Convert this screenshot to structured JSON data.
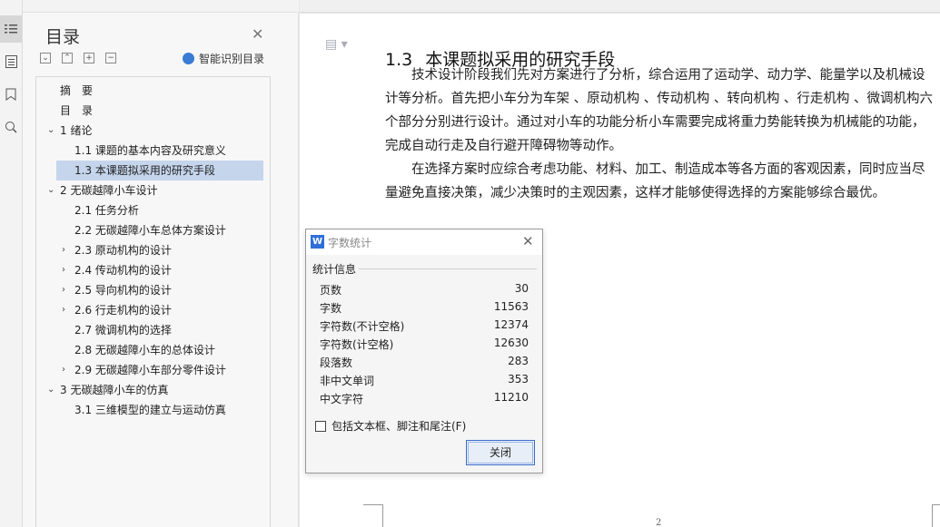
{
  "toc_panel": {
    "title": "目录",
    "smart_toc_label": "智能识别目录",
    "items": [
      {
        "label": "摘　要",
        "level": 0
      },
      {
        "label": "目　录",
        "level": 0
      },
      {
        "label": "1  绪论",
        "level": 0
      },
      {
        "label": "1.1    课题的基本内容及研究意义",
        "level": 1
      },
      {
        "label": "1.3    本课题拟采用的研究手段",
        "level": 1
      },
      {
        "label": "2  无碳越障小车设计",
        "level": 0
      },
      {
        "label": "2.1    任务分析",
        "level": 1
      },
      {
        "label": "2.2    无碳越障小车总体方案设计",
        "level": 1
      },
      {
        "label": "2.3    原动机构的设计",
        "level": 1
      },
      {
        "label": "2.4    传动机构的设计",
        "level": 1
      },
      {
        "label": "2.5    导向机构的设计",
        "level": 1
      },
      {
        "label": "2.6    行走机构的设计",
        "level": 1
      },
      {
        "label": "2.7    微调机构的选择",
        "level": 1
      },
      {
        "label": "2.8    无碳越障小车的总体设计",
        "level": 1
      },
      {
        "label": "2.9    无碳越障小车部分零件设计",
        "level": 1
      },
      {
        "label": "3   无碳越障小车的仿真",
        "level": 0
      },
      {
        "label": "3.1    三维模型的建立与运动仿真",
        "level": 1
      }
    ],
    "selected_index": 4
  },
  "document": {
    "heading_number": "1.3",
    "heading_text": "本课题拟采用的研究手段",
    "paragraph1": "　　技术设计阶段我们先对方案进行了分析，综合运用了运动学、动力学、能量学以及机械设计等分析。首先把小车分为车架 、原动机构 、传动机构 、转向机构 、行走机构 、微调机构六个部分分别进行设计。通过对小车的功能分析小车需要完成将重力势能转换为机械能的功能，完成自动行走及自行避开障碍物等动作。",
    "paragraph2": "　　在选择方案时应综合考虑功能、材料、加工、制造成本等各方面的客观因素，同时应当尽量避免直接决策，减少决策时的主观因素，这样才能够使得选择的方案能够综合最优。",
    "page_number": "2"
  },
  "word_count_dialog": {
    "logo": "W",
    "title": "字数统计",
    "group_label": "统计信息",
    "stats": [
      {
        "label": "页数",
        "value": "30"
      },
      {
        "label": "字数",
        "value": "11563"
      },
      {
        "label": "字符数(不计空格)",
        "value": "12374"
      },
      {
        "label": "字符数(计空格)",
        "value": "12630"
      },
      {
        "label": "段落数",
        "value": "283"
      },
      {
        "label": "非中文单词",
        "value": "353"
      },
      {
        "label": "中文字符",
        "value": "11210"
      }
    ],
    "checkbox_label": "包括文本框、脚注和尾注(F)",
    "checkbox_checked": false,
    "close_button": "关闭"
  },
  "icons": {
    "rail": [
      "toc-icon",
      "page-icon",
      "bookmark-icon",
      "find-icon"
    ],
    "accent": "#3a7bd5",
    "selection_color": "#c5d5ec"
  }
}
